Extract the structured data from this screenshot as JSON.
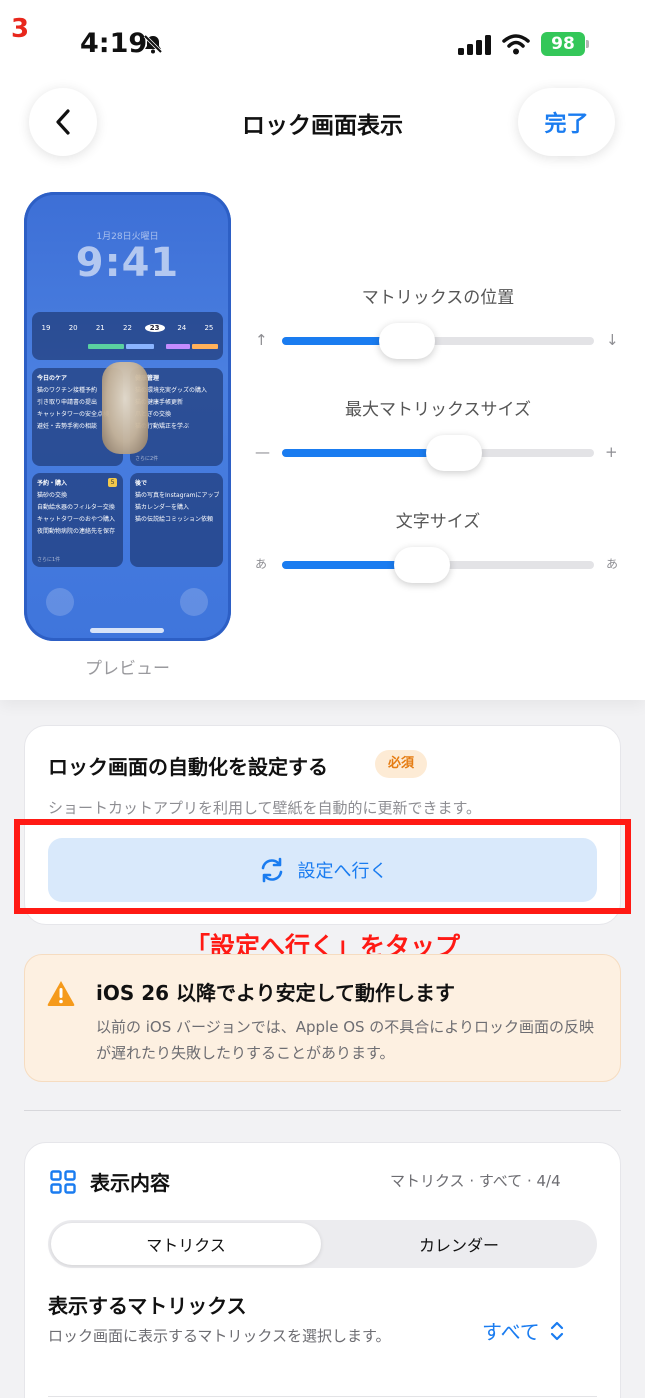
{
  "annotation": {
    "step_number": "3",
    "instruction": "「設定へ行く」をタップ",
    "highlight_color": "#ff1a14"
  },
  "status_bar": {
    "time": "4:19",
    "battery": "98",
    "battery_color": "#34c759",
    "icons": [
      "bell-slash-icon",
      "signal-icon",
      "wifi-icon",
      "battery-charging-icon"
    ]
  },
  "nav": {
    "back_icon": "chevron-left-icon",
    "title": "ロック画面表示",
    "done_label": "完了"
  },
  "accent_color": "#1a7cf0",
  "preview": {
    "label": "プレビュー",
    "date": "1月28日火曜日",
    "clock": "9:41",
    "calendar_days": [
      "19",
      "20",
      "21",
      "22",
      "23",
      "24",
      "25"
    ],
    "calendar_today": "23",
    "cards": [
      {
        "title": "今日のケア",
        "items": [
          "猫のワクチン接種予約",
          "引き取り申請書の提出",
          "キャットタワーの安全点検",
          "避妊・去勢手術の相談"
        ],
        "more": ""
      },
      {
        "title": "健康管理",
        "items": [
          "猫の環境充実グッズの購入",
          "猫の健康手帳更新",
          "爪とぎの交換",
          "猫の行動矯正を学ぶ"
        ],
        "more": "さらに2件"
      },
      {
        "title": "予約・購入",
        "badge": "5",
        "items": [
          "猫砂の交換",
          "自動給水器のフィルター交換",
          "キャットタワーのおやつ購入",
          "夜間動物病院の連絡先を保存"
        ],
        "more": "さらに1件"
      },
      {
        "title": "後で",
        "items": [
          "猫の写真をInstagramにアップロード",
          "猫カレンダーを購入",
          "猫の伝説絵コミッション依頼"
        ],
        "more": ""
      }
    ]
  },
  "sliders": [
    {
      "label": "マトリックスの位置",
      "min_label": "↑",
      "max_label": "↓",
      "value": 0.4
    },
    {
      "label": "最大マトリックスサイズ",
      "min_label": "—",
      "max_label": "+",
      "value": 0.55
    },
    {
      "label": "文字サイズ",
      "min_label": "あ",
      "max_label": "あ",
      "value": 0.45
    }
  ],
  "automation": {
    "title": "ロック画面の自動化を設定する",
    "required_badge": "必須",
    "description": "ショートカットアプリを利用して壁紙を自動的に更新できます。",
    "button_icon": "sync-icon",
    "button_label": "設定へ行く"
  },
  "warning": {
    "icon": "warning-triangle-icon",
    "title": "iOS 26 以降でより安定して動作します",
    "body": "以前の iOS バージョンでは、Apple OS の不具合によりロック画面の反映が遅れたり失敗したりすることがあります。"
  },
  "display_content": {
    "icon": "grid-icon",
    "title": "表示内容",
    "summary": "マトリクス · すべて · 4/4",
    "tabs": [
      {
        "label": "マトリクス",
        "active": true
      },
      {
        "label": "カレンダー",
        "active": false
      }
    ],
    "matrices_title": "表示するマトリックス",
    "matrices_desc": "ロック画面に表示するマトリックスを選択します。",
    "select_value": "すべて",
    "select_icon": "chevron-up-down-icon"
  }
}
